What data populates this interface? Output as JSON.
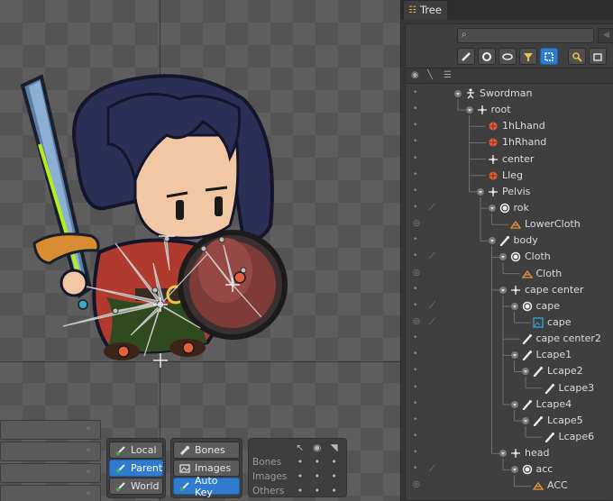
{
  "panel": {
    "tab_label": "Tree",
    "search_placeholder": "",
    "filter_icons": [
      "bone-filter-icon",
      "slot-filter-icon",
      "attachment-filter-icon",
      "constraint-filter-icon",
      "selected-filter-icon",
      "pin-icon",
      "collapse-icon"
    ]
  },
  "tree": [
    {
      "name": "Swordman",
      "type": "skeleton",
      "depth": 0,
      "expanded": true,
      "bone_key": false
    },
    {
      "name": "root",
      "type": "bone",
      "depth": 1,
      "expanded": true,
      "bone_key": false
    },
    {
      "name": "1hLhand",
      "type": "ik",
      "depth": 2,
      "expanded": false,
      "bone_key": false
    },
    {
      "name": "1hRhand",
      "type": "ik",
      "depth": 2,
      "expanded": false,
      "bone_key": false
    },
    {
      "name": "center",
      "type": "bone",
      "depth": 2,
      "expanded": false,
      "bone_key": false
    },
    {
      "name": "Lleg",
      "type": "ik",
      "depth": 2,
      "expanded": false,
      "bone_key": false
    },
    {
      "name": "Pelvis",
      "type": "bone",
      "depth": 2,
      "expanded": true,
      "bone_key": false
    },
    {
      "name": "rok",
      "type": "slot",
      "depth": 3,
      "expanded": true,
      "bone_key": true
    },
    {
      "name": "LowerCloth",
      "type": "mesh",
      "depth": 4,
      "expanded": false,
      "bone_key": false,
      "eye": "ring"
    },
    {
      "name": "body",
      "type": "bone-brush",
      "depth": 3,
      "expanded": true,
      "bone_key": false
    },
    {
      "name": "Cloth",
      "type": "slot",
      "depth": 4,
      "expanded": true,
      "bone_key": true
    },
    {
      "name": "Cloth",
      "type": "mesh",
      "depth": 5,
      "expanded": false,
      "bone_key": false,
      "eye": "ring"
    },
    {
      "name": "cape center",
      "type": "bone",
      "depth": 4,
      "expanded": true,
      "bone_key": false
    },
    {
      "name": "cape",
      "type": "slot",
      "depth": 5,
      "expanded": true,
      "bone_key": true
    },
    {
      "name": "cape",
      "type": "image",
      "depth": 6,
      "expanded": false,
      "bone_key": true,
      "eye": "ring"
    },
    {
      "name": "cape center2",
      "type": "bone-brush",
      "depth": 5,
      "expanded": false,
      "bone_key": false
    },
    {
      "name": "Lcape1",
      "type": "bone-brush",
      "depth": 5,
      "expanded": true,
      "bone_key": false
    },
    {
      "name": "Lcape2",
      "type": "bone-brush",
      "depth": 6,
      "expanded": true,
      "bone_key": false
    },
    {
      "name": "Lcape3",
      "type": "bone-brush",
      "depth": 7,
      "expanded": false,
      "bone_key": false
    },
    {
      "name": "Lcape4",
      "type": "bone-brush",
      "depth": 5,
      "expanded": true,
      "bone_key": false
    },
    {
      "name": "Lcape5",
      "type": "bone-brush",
      "depth": 6,
      "expanded": true,
      "bone_key": false
    },
    {
      "name": "Lcape6",
      "type": "bone-brush",
      "depth": 7,
      "expanded": false,
      "bone_key": false
    },
    {
      "name": "head",
      "type": "bone",
      "depth": 4,
      "expanded": true,
      "bone_key": false
    },
    {
      "name": "acc",
      "type": "slot",
      "depth": 5,
      "expanded": true,
      "bone_key": true
    },
    {
      "name": "ACC",
      "type": "mesh",
      "depth": 6,
      "expanded": false,
      "bone_key": false,
      "eye": "ring"
    }
  ],
  "toolbar": {
    "axes": [
      {
        "label": "Local",
        "active": false
      },
      {
        "label": "Parent",
        "active": true
      },
      {
        "label": "World",
        "active": false
      }
    ],
    "compensate": [
      {
        "label": "Bones",
        "active": false
      },
      {
        "label": "Images",
        "active": false
      },
      {
        "label": "Auto Key",
        "active": true
      }
    ],
    "visibility": {
      "rows": [
        "Bones",
        "Images",
        "Others"
      ],
      "column_icons": [
        "cursor-icon",
        "eye-icon",
        "tag-icon"
      ]
    }
  },
  "colors": {
    "accent": "#2f7bd0",
    "ik_orange": "#e2603a",
    "mesh_orange": "#e7953a",
    "key_green": "#4caa4c",
    "image_blue": "#38a6d8"
  }
}
